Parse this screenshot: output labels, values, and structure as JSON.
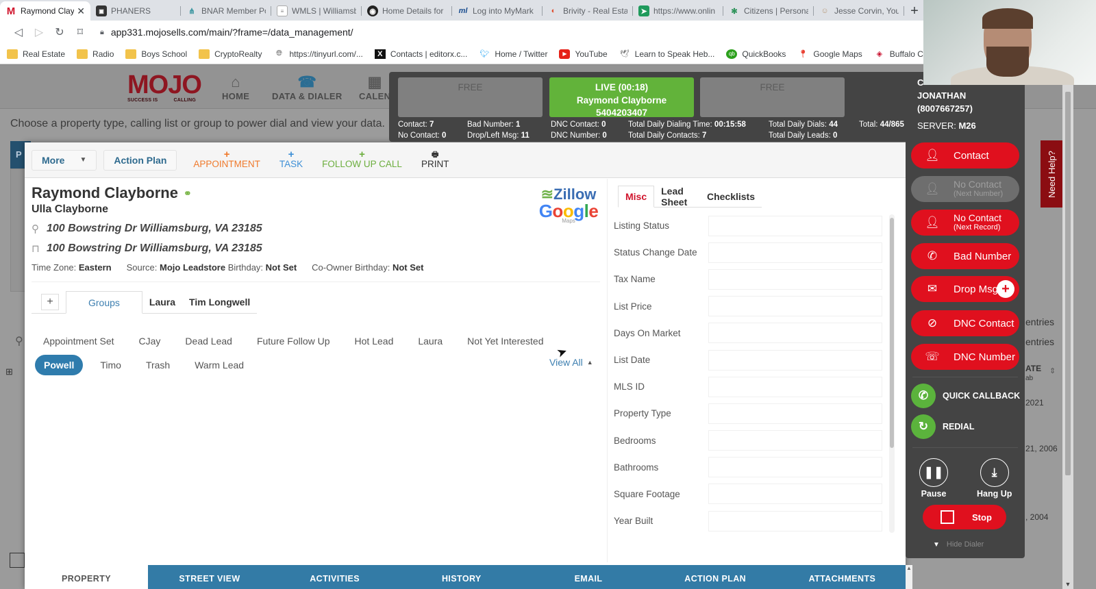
{
  "browser": {
    "tabs": [
      {
        "title": "Raymond Clay",
        "icon": "mojo-icon",
        "active": true
      },
      {
        "title": "PHANERS",
        "icon": "site-icon"
      },
      {
        "title": "BNAR Member Po",
        "icon": "bnar-icon"
      },
      {
        "title": "WMLS | Williamsb",
        "icon": "doc-icon"
      },
      {
        "title": "Home Details for",
        "icon": "home-details-icon"
      },
      {
        "title": "Log into MyMark",
        "icon": "ml-icon"
      },
      {
        "title": "Brivity - Real Estat",
        "icon": "brivity-icon"
      },
      {
        "title": "https://www.onlin",
        "icon": "online-icon"
      },
      {
        "title": "Citizens | Persona",
        "icon": "citizens-icon"
      },
      {
        "title": "Jesse Corvin, Your",
        "icon": "person-icon"
      }
    ],
    "new_tab": "+",
    "url": "app331.mojosells.com/main/?frame=/data_management/",
    "bookmarks": [
      {
        "label": "Real Estate",
        "icon": "folder-icon"
      },
      {
        "label": "Radio",
        "icon": "folder-icon"
      },
      {
        "label": "Boys School",
        "icon": "folder-icon"
      },
      {
        "label": "CryptoRealty",
        "icon": "folder-icon"
      },
      {
        "label": "https://tinyurl.com/...",
        "icon": "globe-icon"
      },
      {
        "label": "Contacts | editorx.c...",
        "icon": "editorx-icon"
      },
      {
        "label": "Home / Twitter",
        "icon": "twitter-icon"
      },
      {
        "label": "YouTube",
        "icon": "youtube-icon"
      },
      {
        "label": "Learn to Speak Heb...",
        "icon": "dove-icon"
      },
      {
        "label": "QuickBooks",
        "icon": "quickbooks-icon"
      },
      {
        "label": "Google Maps",
        "icon": "map-pin-icon"
      },
      {
        "label": "Buffalo Chambe",
        "icon": "buffalo-icon"
      }
    ]
  },
  "app": {
    "logo": {
      "text": "MOJO",
      "tag_left": "SUCCESS IS",
      "tag_right": "CALLING"
    },
    "nav": [
      {
        "label": "HOME",
        "icon": "home-icon"
      },
      {
        "label": "DATA & DIALER",
        "icon": "phone-icon"
      },
      {
        "label": "CALEN",
        "icon": "calendar-icon"
      }
    ],
    "instruction": "Choose a property type, calling list or group to power dial and view your data.",
    "background_right": {
      "entries1": "entries",
      "entries2": "entries",
      "col_header": "ATE",
      "col_sub": "ab",
      "dates": [
        "2021",
        "21, 2006",
        ", 2004"
      ]
    }
  },
  "toolbar": {
    "more": "More",
    "action_plan": "Action Plan",
    "appointment": "APPOINTMENT",
    "task": "TASK",
    "follow_up": "FOLLOW UP CALL",
    "print": "PRINT",
    "plus": "+"
  },
  "contact": {
    "name": "Raymond Clayborne",
    "co_name": "Ulla Clayborne",
    "property_address": "100 Bowstring Dr Williamsburg, VA 23185",
    "mailing_address": "100 Bowstring Dr Williamsburg, VA 23185",
    "time_zone_label": "Time Zone:",
    "time_zone": "Eastern",
    "source_label": "Source:",
    "source": "Mojo Leadstore",
    "birthday_label": "Birthday:",
    "birthday": "Not Set",
    "co_birthday_label": "Co-Owner Birthday:",
    "co_birthday": "Not Set"
  },
  "brands": {
    "zillow": "Zillow",
    "google": "Google",
    "maps": "Maps"
  },
  "groups": {
    "tabs": [
      "Groups",
      "Laura",
      "Tim Longwell"
    ],
    "active_tab": "Groups",
    "row1": [
      "Appointment Set",
      "CJay",
      "Dead Lead",
      "Future Follow Up",
      "Hot Lead",
      "Laura",
      "Not Yet Interested"
    ],
    "row2": [
      "Powell",
      "Timo",
      "Trash",
      "Warm Lead"
    ],
    "selected": "Powell",
    "view_all": "View All"
  },
  "right_panel": {
    "tabs": [
      "Misc",
      "Lead Sheet",
      "Checklists"
    ],
    "active_tab": "Misc",
    "fields": [
      {
        "label": "Listing Status",
        "value": ""
      },
      {
        "label": "Status Change Date",
        "value": ""
      },
      {
        "label": "Tax Name",
        "value": ""
      },
      {
        "label": "List Price",
        "value": ""
      },
      {
        "label": "Days On Market",
        "value": ""
      },
      {
        "label": "List Date",
        "value": ""
      },
      {
        "label": "MLS ID",
        "value": ""
      },
      {
        "label": "Property Type",
        "value": ""
      },
      {
        "label": "Bedrooms",
        "value": ""
      },
      {
        "label": "Bathrooms",
        "value": ""
      },
      {
        "label": "Square Footage",
        "value": ""
      },
      {
        "label": "Year Built",
        "value": ""
      }
    ]
  },
  "bottom_tabs": [
    "PROPERTY",
    "STREET VIEW",
    "ACTIVITIES",
    "HISTORY",
    "EMAIL",
    "ACTION PLAN",
    "ATTACHMENTS"
  ],
  "dialer": {
    "lines": [
      {
        "status": "FREE"
      },
      {
        "status": "LIVE (00:18)",
        "name": "Raymond Clayborne",
        "phone": "5404203407"
      },
      {
        "status": "FREE"
      }
    ],
    "stats": {
      "contact_label": "Contact:",
      "contact": "7",
      "no_contact_label": "No Contact:",
      "no_contact": "0",
      "bad_number_label": "Bad Number:",
      "bad_number": "1",
      "drop_label": "Drop/Left Msg:",
      "drop": "11",
      "dnc_contact_label": "DNC Contact:",
      "dnc_contact": "0",
      "dnc_number_label": "DNC Number:",
      "dnc_number": "0",
      "dialing_time_label": "Total Daily Dialing Time:",
      "dialing_time": "00:15:58",
      "daily_contacts_label": "Total Daily Contacts:",
      "daily_contacts": "7",
      "daily_dials_label": "Total Daily Dials:",
      "daily_dials": "44",
      "daily_leads_label": "Total Daily Leads:",
      "daily_leads": "0",
      "total_label": "Total:",
      "total": "44/865"
    },
    "agent": {
      "line0": "C",
      "name": "JONATHAN",
      "phone": "(8007667257)",
      "server_label": "SERVER:",
      "server": "M26"
    },
    "buttons": {
      "contact": "Contact",
      "no_contact_num": "No Contact",
      "no_contact_num_sub": "(Next Number)",
      "no_contact_rec": "No Contact",
      "no_contact_rec_sub": "(Next Record)",
      "bad_number": "Bad Number",
      "drop_msg": "Drop Msg",
      "dnc_contact": "DNC Contact",
      "dnc_number": "DNC Number",
      "quick_callback": "QUICK CALLBACK",
      "redial": "REDIAL",
      "pause": "Pause",
      "hang_up": "Hang Up",
      "stop": "Stop",
      "hide_dialer": "Hide Dialer"
    },
    "need_help": "Need Help?"
  }
}
